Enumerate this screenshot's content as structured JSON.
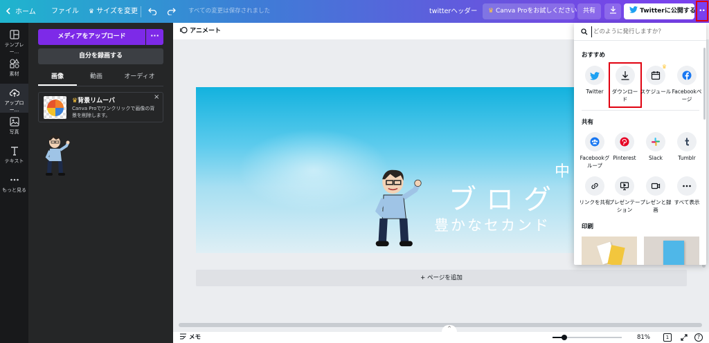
{
  "topbar": {
    "home_label": "ホーム",
    "file_label": "ファイル",
    "resize_label": "サイズを変更",
    "saved_status": "すべての変更は保存されました",
    "doc_title": "twitterヘッダー",
    "pro_trial_label": "Canva Proをお試しください",
    "share_label": "共有",
    "publish_label": "Twitterに公開する"
  },
  "rail": {
    "items": [
      {
        "label": "テンプレー...",
        "icon": "layout-icon"
      },
      {
        "label": "素材",
        "icon": "shapes-icon"
      },
      {
        "label": "アップロー...",
        "icon": "cloud-upload-icon"
      },
      {
        "label": "写真",
        "icon": "image-icon"
      },
      {
        "label": "テキスト",
        "icon": "text-icon"
      },
      {
        "label": "もっと見る",
        "icon": "more-dots-icon"
      }
    ]
  },
  "upload_panel": {
    "upload_button": "メディアをアップロード",
    "record_button": "自分を録画する",
    "tabs": [
      "画像",
      "動画",
      "オーディオ"
    ],
    "promo_title": "背景リムーバ",
    "promo_text": "Canva Proでワンクリックで画像の背景を削除します。"
  },
  "editor": {
    "animate_label": "アニメート",
    "add_page_label": "+ ページを追加",
    "banner_text_top": "中",
    "banner_text_main": "ブログ",
    "banner_text_sub": "豊かなセカンド"
  },
  "bottombar": {
    "notes_label": "メモ",
    "zoom": "81%",
    "page_count": "1"
  },
  "share_dropdown": {
    "search_placeholder": "どのように発行しますか？",
    "recommended_heading": "おすすめ",
    "recommended": [
      {
        "label": "Twitter",
        "icon": "twitter-icon"
      },
      {
        "label": "ダウンロード",
        "icon": "download-icon"
      },
      {
        "label": "スケジュール",
        "icon": "calendar-icon"
      },
      {
        "label": "Facebookページ",
        "icon": "facebook-icon"
      }
    ],
    "share_heading": "共有",
    "share_items": [
      {
        "label": "Facebookグループ",
        "icon": "facebook-group-icon"
      },
      {
        "label": "Pinterest",
        "icon": "pinterest-icon"
      },
      {
        "label": "Slack",
        "icon": "slack-icon"
      },
      {
        "label": "Tumblr",
        "icon": "tumblr-icon"
      },
      {
        "label": "リンクを共有",
        "icon": "link-icon"
      },
      {
        "label": "プレゼンテーション",
        "icon": "present-icon"
      },
      {
        "label": "プレゼンと録画",
        "icon": "record-icon"
      },
      {
        "label": "すべて表示",
        "icon": "more-icon"
      }
    ],
    "print_heading": "印刷"
  },
  "colors": {
    "accent_purple": "#7d2ae8",
    "highlight_red": "#e0000f",
    "twitter_blue": "#1da1f2",
    "facebook_blue": "#1877f2",
    "pinterest_red": "#e60023",
    "tumblr_navy": "#35465c",
    "pro_crown": "#ffc83d"
  }
}
